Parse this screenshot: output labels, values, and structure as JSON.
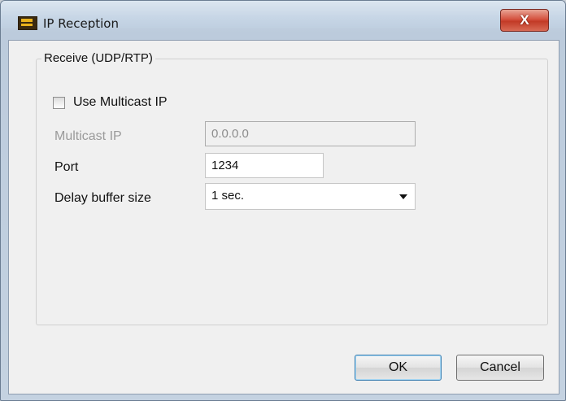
{
  "window": {
    "title": "IP Reception",
    "close_label": "X"
  },
  "group": {
    "title": "Receive (UDP/RTP)"
  },
  "multicast_checkbox": {
    "label": "Use Multicast IP",
    "checked": false
  },
  "multicast_ip": {
    "label": "Multicast IP",
    "value": "0.0.0.0",
    "enabled": false
  },
  "port": {
    "label": "Port",
    "value": "1234"
  },
  "delay_buffer": {
    "label": "Delay buffer size",
    "selected": "1 sec."
  },
  "buttons": {
    "ok_label": "OK",
    "cancel_label": "Cancel"
  },
  "colors": {
    "close_button": "#c23a26",
    "default_button_border": "#3c7fb1"
  },
  "icons": {
    "app": "app-logo-icon",
    "dropdown": "chevron-down-icon"
  }
}
